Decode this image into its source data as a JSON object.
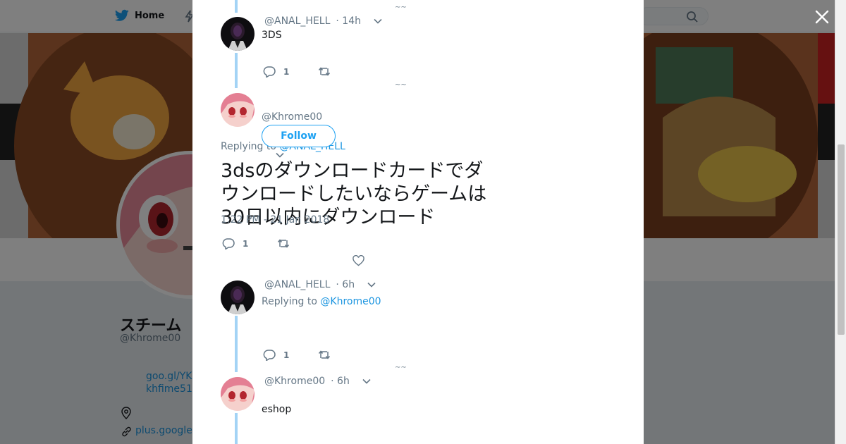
{
  "background": {
    "nav": {
      "home_label": "Home"
    },
    "profile": {
      "name": "スチーム",
      "handle": "@Khrome00",
      "link1": "goo.gl/YK",
      "link2": "khfime51",
      "link3": "plus.google"
    }
  },
  "colors": {
    "accent": "#1da1f2",
    "link": "#1b95e0",
    "thread_line": "#a3d3f5",
    "muted_text": "#657786"
  },
  "thread": {
    "tweet1": {
      "handle": "@ANAL_HELL",
      "time": "· 14h",
      "text": "3DS",
      "reply_count": "1"
    },
    "focused": {
      "handle": "@Khrome00",
      "follow_label": "Follow",
      "replying_prefix": "Replying to ",
      "replying_to": "@ANAL_HELL",
      "text": "3dsのダウンロードカードでダウンロードしたいならゲームは30日以内にダウンロード",
      "timestamp": "1:22 PM - 21 Jan 2018",
      "reply_count": "1"
    },
    "tweet3": {
      "handle": "@ANAL_HELL",
      "time": "· 6h",
      "replying_prefix": "Replying to ",
      "replying_to": "@Khrome00",
      "reply_count": "1"
    },
    "tweet4": {
      "handle": "@Khrome00",
      "time": "· 6h",
      "text": "eshop"
    }
  },
  "icons": [
    "twitter-bird-icon",
    "bolt-icon",
    "search-icon",
    "close-icon",
    "reply-icon",
    "retweet-icon",
    "like-icon",
    "chevron-down-icon",
    "location-icon",
    "link-icon"
  ]
}
